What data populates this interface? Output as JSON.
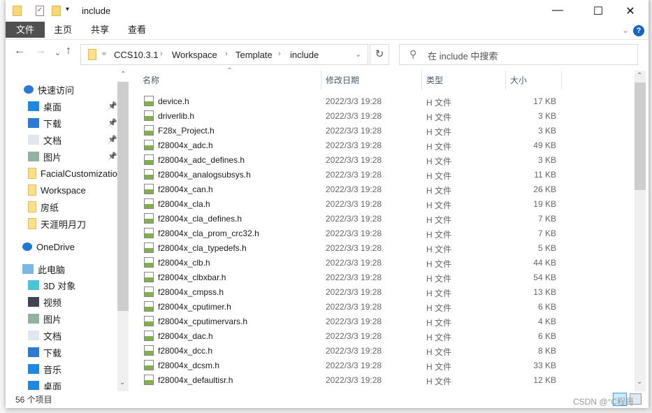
{
  "window": {
    "title": "include",
    "controls": [
      "minimize",
      "maximize",
      "close"
    ]
  },
  "ribbon": {
    "tabs": [
      "文件",
      "主页",
      "共享",
      "查看"
    ]
  },
  "address": {
    "overflow": "«",
    "crumbs": [
      "CCS10.3.1",
      "Workspace",
      "Template",
      "include"
    ]
  },
  "search": {
    "placeholder": "在 include 中搜索"
  },
  "sidebar": {
    "quick_access": "快速访问",
    "quick_items": [
      {
        "label": "桌面",
        "icon": "desktop-icon",
        "pinned": true
      },
      {
        "label": "下载",
        "icon": "download-icon",
        "pinned": true
      },
      {
        "label": "文档",
        "icon": "document-icon",
        "pinned": true
      },
      {
        "label": "图片",
        "icon": "pictures-icon",
        "pinned": true
      },
      {
        "label": "FacialCustomizatio",
        "icon": "folder-icon"
      },
      {
        "label": "Workspace",
        "icon": "folder-icon"
      },
      {
        "label": "房纸",
        "icon": "folder-icon"
      },
      {
        "label": "天涯明月刀",
        "icon": "folder-icon"
      }
    ],
    "onedrive": "OneDrive",
    "this_pc": "此电脑",
    "pc_items": [
      {
        "label": "3D 对象",
        "icon": "3d-objects-icon"
      },
      {
        "label": "视频",
        "icon": "video-icon"
      },
      {
        "label": "图片",
        "icon": "pictures-icon"
      },
      {
        "label": "文档",
        "icon": "document-icon"
      },
      {
        "label": "下载",
        "icon": "download-icon"
      },
      {
        "label": "音乐",
        "icon": "music-icon"
      },
      {
        "label": "桌面",
        "icon": "desktop-icon"
      }
    ]
  },
  "columns": [
    "名称",
    "修改日期",
    "类型",
    "大小"
  ],
  "files": [
    [
      "device.h",
      "2022/3/3 19:28",
      "H 文件",
      "17 KB"
    ],
    [
      "driverlib.h",
      "2022/3/3 19:28",
      "H 文件",
      "3 KB"
    ],
    [
      "F28x_Project.h",
      "2022/3/3 19:28",
      "H 文件",
      "3 KB"
    ],
    [
      "f28004x_adc.h",
      "2022/3/3 19:28",
      "H 文件",
      "49 KB"
    ],
    [
      "f28004x_adc_defines.h",
      "2022/3/3 19:28",
      "H 文件",
      "3 KB"
    ],
    [
      "f28004x_analogsubsys.h",
      "2022/3/3 19:28",
      "H 文件",
      "11 KB"
    ],
    [
      "f28004x_can.h",
      "2022/3/3 19:28",
      "H 文件",
      "26 KB"
    ],
    [
      "f28004x_cla.h",
      "2022/3/3 19:28",
      "H 文件",
      "19 KB"
    ],
    [
      "f28004x_cla_defines.h",
      "2022/3/3 19:28",
      "H 文件",
      "7 KB"
    ],
    [
      "f28004x_cla_prom_crc32.h",
      "2022/3/3 19:28",
      "H 文件",
      "7 KB"
    ],
    [
      "f28004x_cla_typedefs.h",
      "2022/3/3 19:28",
      "H 文件",
      "5 KB"
    ],
    [
      "f28004x_clb.h",
      "2022/3/3 19:28",
      "H 文件",
      "44 KB"
    ],
    [
      "f28004x_clbxbar.h",
      "2022/3/3 19:28",
      "H 文件",
      "54 KB"
    ],
    [
      "f28004x_cmpss.h",
      "2022/3/3 19:28",
      "H 文件",
      "13 KB"
    ],
    [
      "f28004x_cputimer.h",
      "2022/3/3 19:28",
      "H 文件",
      "6 KB"
    ],
    [
      "f28004x_cputimervars.h",
      "2022/3/3 19:28",
      "H 文件",
      "4 KB"
    ],
    [
      "f28004x_dac.h",
      "2022/3/3 19:28",
      "H 文件",
      "6 KB"
    ],
    [
      "f28004x_dcc.h",
      "2022/3/3 19:28",
      "H 文件",
      "8 KB"
    ],
    [
      "f28004x_dcsm.h",
      "2022/3/3 19:28",
      "H 文件",
      "33 KB"
    ],
    [
      "f28004x_defaultisr.h",
      "2022/3/3 19:28",
      "H 文件",
      "12 KB"
    ]
  ],
  "status": {
    "count": "56 个项目"
  },
  "watermark": "CSDN @°C程哥",
  "colors": {
    "file_tab": "#505050",
    "accent": "#1565c0"
  }
}
